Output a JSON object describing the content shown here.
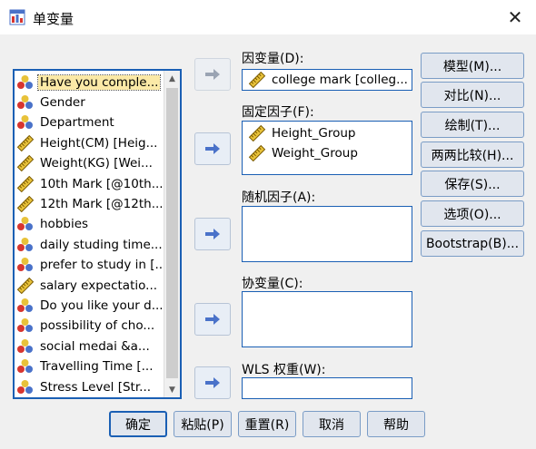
{
  "window": {
    "title": "单变量",
    "close_glyph": "✕"
  },
  "variables": [
    {
      "label": "Have you comple...",
      "icon": "nominal-icon",
      "selected": true
    },
    {
      "label": "Gender",
      "icon": "nominal-icon"
    },
    {
      "label": "Department",
      "icon": "nominal-icon"
    },
    {
      "label": "Height(CM) [Heig...",
      "icon": "scale-icon"
    },
    {
      "label": "Weight(KG) [Wei...",
      "icon": "scale-icon"
    },
    {
      "label": "10th Mark [@10th...",
      "icon": "scale-icon"
    },
    {
      "label": "12th Mark [@12th...",
      "icon": "scale-icon"
    },
    {
      "label": "hobbies",
      "icon": "nominal-icon"
    },
    {
      "label": "daily studing time...",
      "icon": "nominal-icon"
    },
    {
      "label": "prefer to study in [...",
      "icon": "nominal-icon"
    },
    {
      "label": "salary expectatio...",
      "icon": "scale-icon"
    },
    {
      "label": "Do you like your d...",
      "icon": "nominal-icon"
    },
    {
      "label": "possibility of cho...",
      "icon": "nominal-icon"
    },
    {
      "label": "social medai &a...",
      "icon": "nominal-icon"
    },
    {
      "label": "Travelling Time  [...",
      "icon": "nominal-icon"
    },
    {
      "label": "Stress Level  [Str...",
      "icon": "nominal-icon"
    }
  ],
  "dependent": {
    "label": "因变量(D):",
    "value": "college mark [colleg...",
    "icon": "scale-icon"
  },
  "fixed_factors": {
    "label": "固定因子(F):",
    "items": [
      {
        "label": "Height_Group",
        "icon": "scale-icon"
      },
      {
        "label": "Weight_Group",
        "icon": "scale-icon"
      }
    ]
  },
  "random_factors": {
    "label": "随机因子(A):"
  },
  "covariates": {
    "label": "协变量(C):"
  },
  "wls": {
    "label": "WLS 权重(W):"
  },
  "side_buttons": {
    "model": "模型(M)...",
    "contrast": "对比(N)...",
    "plots": "绘制(T)...",
    "posthoc": "两两比较(H)...",
    "save": "保存(S)...",
    "options": "选项(O)...",
    "bootstrap": "Bootstrap(B)..."
  },
  "bottom_buttons": {
    "ok": "确定",
    "paste": "粘贴(P)",
    "reset": "重置(R)",
    "cancel": "取消",
    "help": "帮助"
  },
  "colors": {
    "accent": "#1a5fb4",
    "arrow": "#4a72c9",
    "selected_bg": "#fbe9a7"
  }
}
